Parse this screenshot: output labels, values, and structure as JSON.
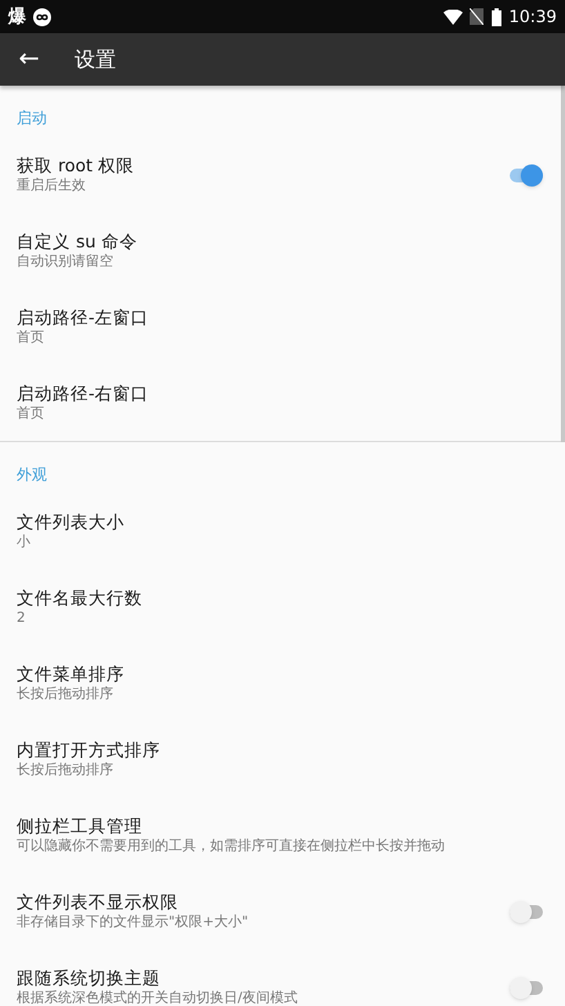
{
  "status_bar": {
    "notification": "爆",
    "time": "10:39"
  },
  "toolbar": {
    "back": "←",
    "title": "设置"
  },
  "sections": [
    {
      "header": "启动",
      "items": [
        {
          "kind": "switch",
          "title": "获取 root 权限",
          "summary": "重启后生效",
          "on": true
        },
        {
          "kind": "plain",
          "title": "自定义 su 命令",
          "summary": "自动识别请留空"
        },
        {
          "kind": "plain",
          "title": "启动路径-左窗口",
          "summary": "首页"
        },
        {
          "kind": "plain",
          "title": "启动路径-右窗口",
          "summary": "首页"
        }
      ]
    },
    {
      "header": "外观",
      "items": [
        {
          "kind": "plain",
          "title": "文件列表大小",
          "summary": "小"
        },
        {
          "kind": "plain",
          "title": "文件名最大行数",
          "summary": "2"
        },
        {
          "kind": "plain",
          "title": "文件菜单排序",
          "summary": "长按后拖动排序"
        },
        {
          "kind": "plain",
          "title": "内置打开方式排序",
          "summary": "长按后拖动排序"
        },
        {
          "kind": "plain",
          "title": "侧拉栏工具管理",
          "summary": "可以隐藏你不需要用到的工具，如需排序可直接在侧拉栏中长按并拖动"
        },
        {
          "kind": "switch",
          "title": "文件列表不显示权限",
          "summary": "非存储目录下的文件显示\"权限+大小\"",
          "on": false
        },
        {
          "kind": "switch",
          "title": "跟随系统切换主题",
          "summary": "根据系统深色模式的开关自动切换日/夜间模式",
          "on": false
        }
      ]
    }
  ]
}
